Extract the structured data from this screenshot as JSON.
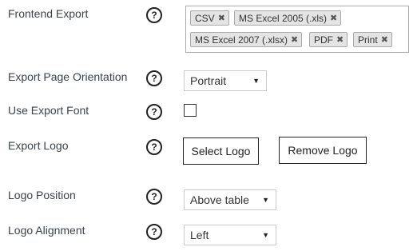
{
  "frontend_export": {
    "label": "Frontend Export",
    "help": "?",
    "tags": [
      {
        "label": "CSV",
        "remove": "✖"
      },
      {
        "label": "MS Excel 2005 (.xls)",
        "remove": "✖"
      },
      {
        "label": "MS Excel 2007 (.xlsx)",
        "remove": "✖"
      },
      {
        "label": "PDF",
        "remove": "✖"
      },
      {
        "label": "Print",
        "remove": "✖"
      }
    ]
  },
  "orientation": {
    "label": "Export Page Orientation",
    "help": "?",
    "value": "Portrait",
    "arrow": "▼"
  },
  "export_font": {
    "label": "Use Export Font",
    "help": "?",
    "checked": false
  },
  "export_logo": {
    "label": "Export Logo",
    "help": "?",
    "select_label": "Select Logo",
    "remove_label": "Remove Logo"
  },
  "logo_position": {
    "label": "Logo Position",
    "help": "?",
    "value": "Above table",
    "arrow": "▼"
  },
  "logo_alignment": {
    "label": "Logo Alignment",
    "help": "?",
    "value": "Left",
    "arrow": "▼"
  }
}
